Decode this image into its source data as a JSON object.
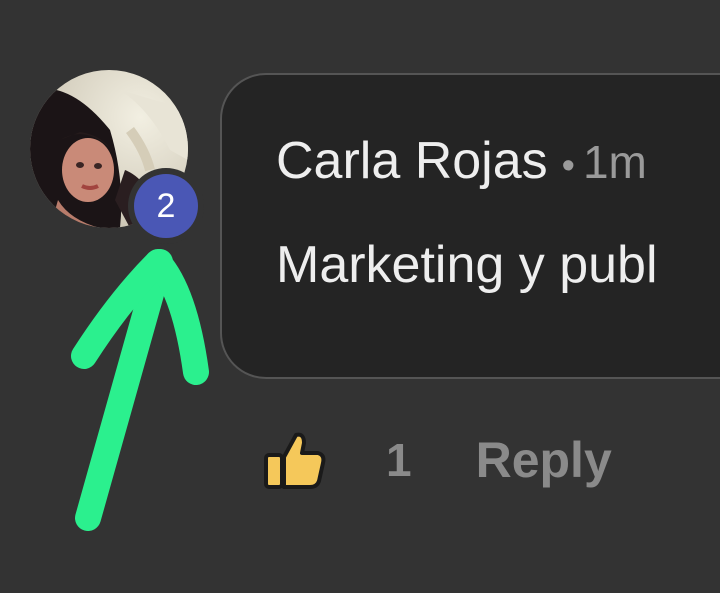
{
  "comment": {
    "author": "Carla Rojas",
    "separator": "•",
    "time": "1m",
    "text": "Marketing y publ"
  },
  "avatar": {
    "badge_count": "2",
    "badge_color": "#4a57b5"
  },
  "actions": {
    "like_icon": "thumbs-up-icon",
    "like_count": "1",
    "reply_label": "Reply"
  },
  "annotation": {
    "arrow_color": "#2bf08e",
    "icon": "arrow-annotation"
  },
  "colors": {
    "background": "#333333",
    "bubble": "#242424",
    "like_icon": "#f5c85a"
  }
}
